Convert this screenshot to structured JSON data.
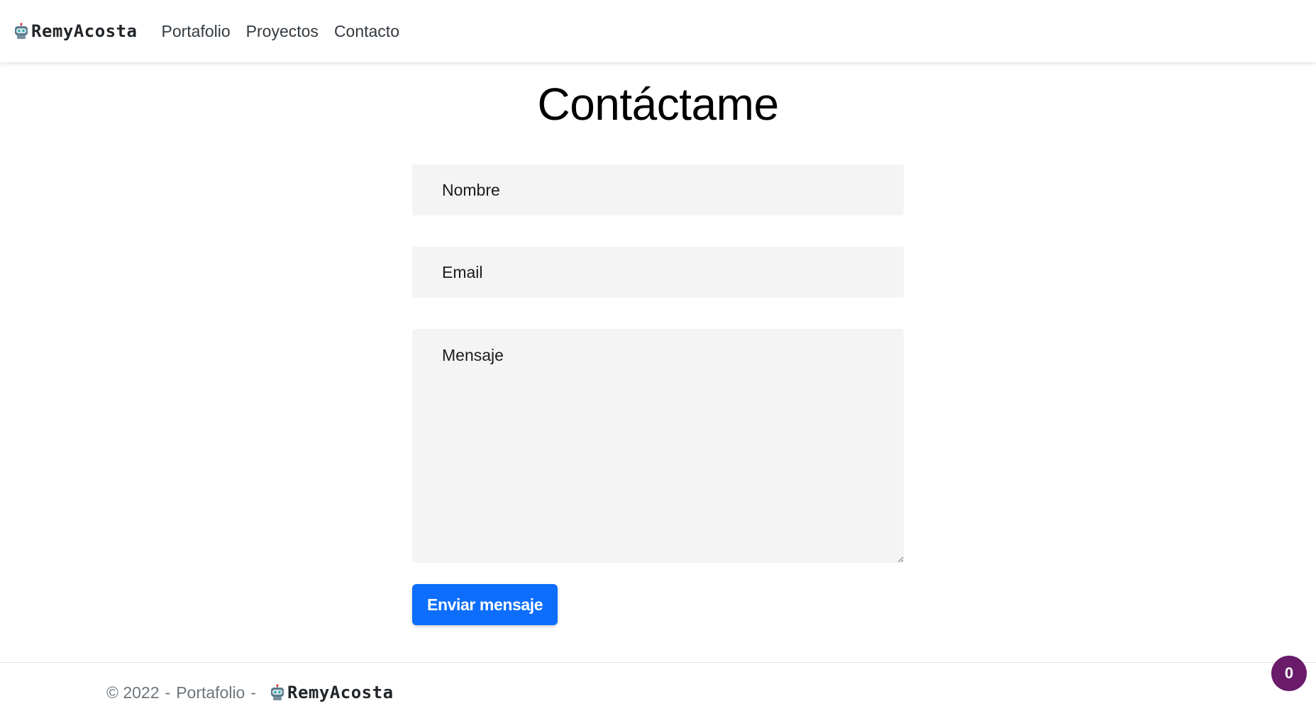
{
  "navbar": {
    "brand": "RemyAcosta",
    "brand_icon": "robot-icon",
    "links": [
      {
        "label": "Portafolio"
      },
      {
        "label": "Proyectos"
      },
      {
        "label": "Contacto"
      }
    ]
  },
  "main": {
    "title": "Contáctame",
    "form": {
      "name_placeholder": "Nombre",
      "email_placeholder": "Email",
      "message_placeholder": "Mensaje",
      "submit_label": "Enviar mensaje"
    }
  },
  "footer": {
    "copyright": "© 2022",
    "separator": "-",
    "section": "Portafolio",
    "brand": "RemyAcosta"
  },
  "badge": {
    "count": "0"
  },
  "colors": {
    "accent": "#0d6efd",
    "badge": "#6a1b6a",
    "field_bg": "#f4f4f4"
  }
}
